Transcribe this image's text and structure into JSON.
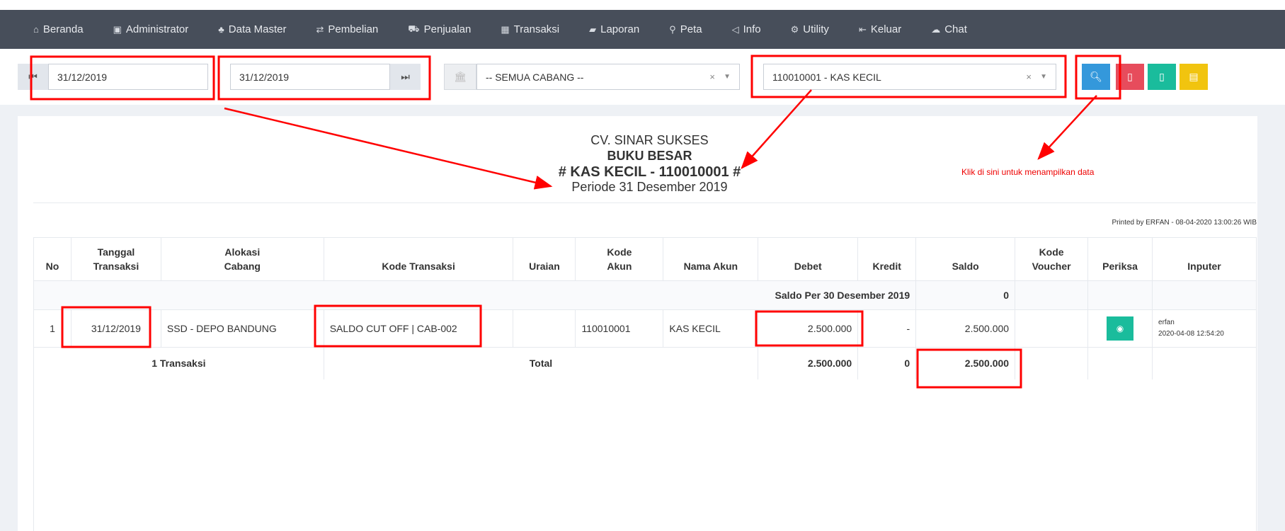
{
  "nav": [
    {
      "icon": "home-icon",
      "glyph": "⌂",
      "label": "Beranda"
    },
    {
      "icon": "briefcase-icon",
      "glyph": "▣",
      "label": "Administrator"
    },
    {
      "icon": "sitemap-icon",
      "glyph": "♣",
      "label": "Data Master"
    },
    {
      "icon": "random-icon",
      "glyph": "⇄",
      "label": "Pembelian"
    },
    {
      "icon": "cart-icon",
      "glyph": "⛟",
      "label": "Penjualan"
    },
    {
      "icon": "calculator-icon",
      "glyph": "▦",
      "label": "Transaksi"
    },
    {
      "icon": "folder-open-icon",
      "glyph": "▰",
      "label": "Laporan"
    },
    {
      "icon": "map-marker-icon",
      "glyph": "⚲",
      "label": "Peta"
    },
    {
      "icon": "bullhorn-icon",
      "glyph": "◁",
      "label": "Info"
    },
    {
      "icon": "cogs-icon",
      "glyph": "⚙",
      "label": "Utility"
    },
    {
      "icon": "sign-out-icon",
      "glyph": "⇤",
      "label": "Keluar"
    },
    {
      "icon": "chat-icon",
      "glyph": "☁",
      "label": "Chat"
    }
  ],
  "filters": {
    "date_from": "31/12/2019",
    "date_to": "31/12/2019",
    "branch": "-- SEMUA CABANG --",
    "account": "110010001 - KAS KECIL",
    "clear": "×",
    "caret": "▼"
  },
  "report": {
    "company": "CV. SINAR SUKSES",
    "title": "BUKU BESAR",
    "account": "# KAS KECIL - 110010001 #",
    "period": "Periode 31 Desember 2019",
    "printed": "Printed by ERFAN - 08-04-2020 13:00:26 WIB"
  },
  "table": {
    "headers": [
      "No",
      "Tanggal\nTransaksi",
      "Alokasi\nCabang",
      "Kode Transaksi",
      "Uraian",
      "Kode\nAkun",
      "Nama Akun",
      "Debet",
      "Kredit",
      "Saldo",
      "Kode\nVoucher",
      "Periksa",
      "Inputer"
    ],
    "opening": {
      "label": "Saldo Per 30 Desember 2019",
      "saldo": "0"
    },
    "rows": [
      {
        "no": "1",
        "tanggal": "31/12/2019",
        "cabang": "SSD - DEPO BANDUNG",
        "kode": "SALDO CUT OFF | CAB-002",
        "uraian": "",
        "akun": "110010001",
        "nama": "KAS KECIL",
        "debet": "2.500.000",
        "kredit": "-",
        "saldo": "2.500.000",
        "voucher": "",
        "inputer": "erfan",
        "inputer_time": "2020-04-08 12:54:20"
      }
    ],
    "total": {
      "count": "1 Transaksi",
      "label": "Total",
      "debet": "2.500.000",
      "kredit": "0",
      "saldo": "2.500.000"
    }
  },
  "annotation": {
    "hint": "Klik di sini untuk menampilkan data",
    "color": "#ff0000"
  },
  "colors": {
    "nav": "#474e5a",
    "search": "#3498db",
    "pdf": "#e74c5c",
    "excel": "#1abc9c",
    "doc": "#f1c40f"
  }
}
